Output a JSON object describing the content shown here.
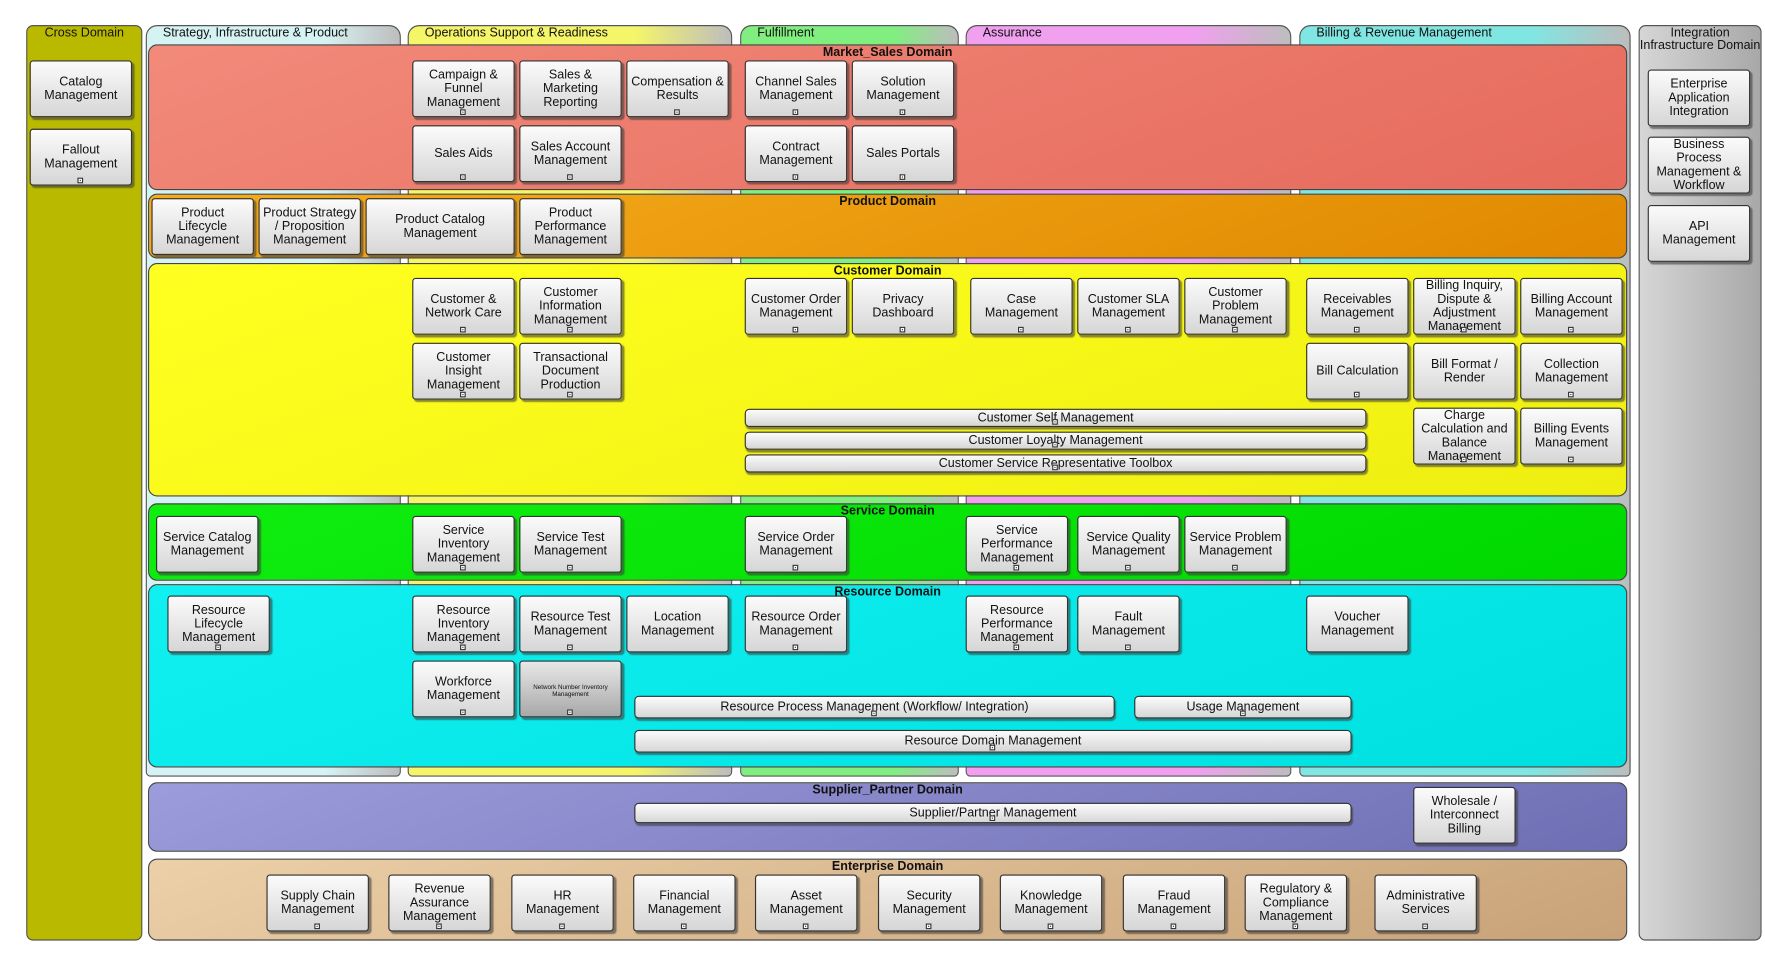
{
  "columns": [
    {
      "label": "Strategy, Infrastructure & Product",
      "color": "#d6f3f3"
    },
    {
      "label": "Operations Support & Readiness",
      "color": "#f5f56a"
    },
    {
      "label": "Fulfillment",
      "color": "#80ef80"
    },
    {
      "label": "Assurance",
      "color": "#f0a0ee"
    },
    {
      "label": "Billing & Revenue Management",
      "color": "#80e6e2"
    }
  ],
  "cross_domain": {
    "title": "Cross Domain",
    "color": "#b9b900",
    "boxes": [
      {
        "label": "Catalog Management",
        "icon": false
      },
      {
        "label": "Fallout Management",
        "icon": true
      }
    ]
  },
  "integration": {
    "title": "Integration Infrastructure Domain",
    "color": "#c4c4c4",
    "boxes": [
      {
        "label": "Enterprise Application Integration",
        "icon": false
      },
      {
        "label": "Business Process Management & Workflow",
        "icon": false
      },
      {
        "label": "API Management",
        "icon": false
      }
    ]
  },
  "domains": [
    {
      "key": "market",
      "title": "Market_Sales Domain",
      "color": "#e56a5c",
      "color2": "#f28a7a",
      "boxes": [
        {
          "label": "Campaign & Funnel Management",
          "icon": true
        },
        {
          "label": "Sales & Marketing Reporting",
          "icon": false
        },
        {
          "label": "Compensation & Results",
          "icon": true
        },
        {
          "label": "Channel Sales Management",
          "icon": true
        },
        {
          "label": "Solution Management",
          "icon": true
        },
        {
          "label": "Sales Aids",
          "icon": true
        },
        {
          "label": "Sales Account Management",
          "icon": true
        },
        {
          "label": "Contract Management",
          "icon": true
        },
        {
          "label": "Sales Portals",
          "icon": true
        }
      ],
      "bars": []
    },
    {
      "key": "product",
      "title": "Product Domain",
      "color": "#e08800",
      "color2": "#f5ad1c",
      "boxes": [
        {
          "label": "Product Lifecycle Management",
          "icon": false
        },
        {
          "label": "Product Strategy / Proposition Management",
          "icon": false
        },
        {
          "label": "Product Catalog Management",
          "icon": false
        },
        {
          "label": "Product Performance Management",
          "icon": false
        }
      ],
      "bars": []
    },
    {
      "key": "customer",
      "title": "Customer Domain",
      "color": "#eeee10",
      "color2": "#ffff20",
      "boxes": [
        {
          "label": "Customer & Network Care",
          "icon": true
        },
        {
          "label": "Customer Information Management",
          "icon": true
        },
        {
          "label": "Customer Insight Management",
          "icon": true
        },
        {
          "label": "Transactional Document Production",
          "icon": true
        },
        {
          "label": "Customer Order Management",
          "icon": true
        },
        {
          "label": "Privacy Dashboard",
          "icon": true
        },
        {
          "label": "Case Management",
          "icon": true
        },
        {
          "label": "Customer SLA Management",
          "icon": true
        },
        {
          "label": "Customer Problem Management",
          "icon": true
        },
        {
          "label": "Receivables Management",
          "icon": true
        },
        {
          "label": "Billing Inquiry, Dispute & Adjustment Management",
          "icon": true
        },
        {
          "label": "Billing Account Management",
          "icon": true
        },
        {
          "label": "Bill Calculation",
          "icon": true
        },
        {
          "label": "Bill Format / Render",
          "icon": false
        },
        {
          "label": "Collection Management",
          "icon": true
        },
        {
          "label": "Charge Calculation and Balance Management",
          "icon": true
        },
        {
          "label": "Billing Events Management",
          "icon": true
        }
      ],
      "bars": [
        {
          "label": "Customer Self Management",
          "icon": true
        },
        {
          "label": "Customer Loyalty Management",
          "icon": true
        },
        {
          "label": "Customer Service Representative Toolbox",
          "icon": true
        }
      ]
    },
    {
      "key": "service",
      "title": "Service Domain",
      "color": "#00d800",
      "color2": "#10ee10",
      "boxes": [
        {
          "label": "Service Catalog Management",
          "icon": false
        },
        {
          "label": "Service Inventory Management",
          "icon": true
        },
        {
          "label": "Service Test Management",
          "icon": true
        },
        {
          "label": "Service Order Management",
          "icon": true
        },
        {
          "label": "Service Performance Management",
          "icon": true
        },
        {
          "label": "Service Quality Management",
          "icon": true
        },
        {
          "label": "Service Problem Management",
          "icon": true
        }
      ],
      "bars": []
    },
    {
      "key": "resource",
      "title": "Resource Domain",
      "color": "#00e0e0",
      "color2": "#10f0f0",
      "boxes": [
        {
          "label": "Resource Lifecycle Management",
          "icon": true
        },
        {
          "label": "Resource Inventory Management",
          "icon": true
        },
        {
          "label": "Resource Test Management",
          "icon": true
        },
        {
          "label": "Location Management",
          "icon": false
        },
        {
          "label": "Resource Order Management",
          "icon": true
        },
        {
          "label": "Resource Performance Management",
          "icon": true
        },
        {
          "label": "Fault Management",
          "icon": true
        },
        {
          "label": "Voucher Management",
          "icon": false
        },
        {
          "label": "Workforce Management",
          "icon": true
        },
        {
          "label": "Network Number Inventory Management",
          "icon": true
        }
      ],
      "bars": [
        {
          "label": "Resource Process Management (Workflow/ Integration)",
          "icon": true
        },
        {
          "label": "Usage Management",
          "icon": true
        },
        {
          "label": "Resource Domain Management",
          "icon": true
        }
      ]
    },
    {
      "key": "supplier",
      "title": "Supplier_Partner Domain",
      "color": "#6e6eb4",
      "color2": "#9c9cdc",
      "boxes": [
        {
          "label": "Wholesale / Interconnect Billing",
          "icon": false
        }
      ],
      "bars": [
        {
          "label": "Supplier/Partner Management",
          "icon": true
        }
      ]
    },
    {
      "key": "enterprise",
      "title": "Enterprise Domain",
      "color": "#c8a278",
      "color2": "#ecd0a8",
      "boxes": [
        {
          "label": "Supply Chain Management",
          "icon": true
        },
        {
          "label": "Revenue Assurance Management",
          "icon": true
        },
        {
          "label": "HR Management",
          "icon": true
        },
        {
          "label": "Financial Management",
          "icon": true
        },
        {
          "label": "Asset Management",
          "icon": true
        },
        {
          "label": "Security Management",
          "icon": true
        },
        {
          "label": "Knowledge Management",
          "icon": true
        },
        {
          "label": "Fraud Management",
          "icon": true
        },
        {
          "label": "Regulatory & Compliance Management",
          "icon": true
        },
        {
          "label": "Administrative Services",
          "icon": true
        }
      ],
      "bars": []
    }
  ]
}
